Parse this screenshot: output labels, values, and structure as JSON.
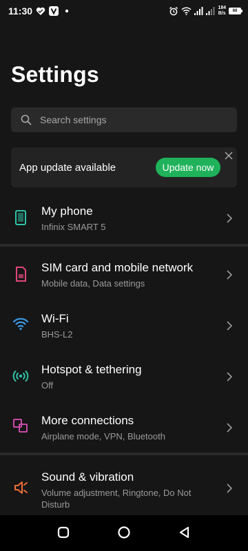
{
  "status_bar": {
    "time": "11:30",
    "net_speed_value": "184",
    "net_speed_unit": "B/s",
    "battery": "88"
  },
  "page": {
    "title": "Settings"
  },
  "search": {
    "placeholder": "Search settings"
  },
  "update_banner": {
    "text": "App update available",
    "button_label": "Update now",
    "button_color": "#1fb25a"
  },
  "items": [
    {
      "title": "My phone",
      "subtitle": "Infinix SMART 5",
      "icon": "phone-icon",
      "icon_color": "#2fc4a8"
    },
    {
      "title": "SIM card and mobile network",
      "subtitle": "Mobile data, Data settings",
      "icon": "sim-card-icon",
      "icon_color": "#e0457b"
    },
    {
      "title": "Wi-Fi",
      "subtitle": "BHS-L2",
      "icon": "wifi-icon",
      "icon_color": "#3b9ae8"
    },
    {
      "title": "Hotspot & tethering",
      "subtitle": "Off",
      "icon": "hotspot-icon",
      "icon_color": "#2fc4a8"
    },
    {
      "title": "More connections",
      "subtitle": "Airplane mode, VPN, Bluetooth",
      "icon": "connections-icon",
      "icon_color": "#c94aa8"
    },
    {
      "title": "Sound & vibration",
      "subtitle": "Volume adjustment, Ringtone, Do Not Disturb",
      "icon": "speaker-icon",
      "icon_color": "#f0703a"
    }
  ]
}
